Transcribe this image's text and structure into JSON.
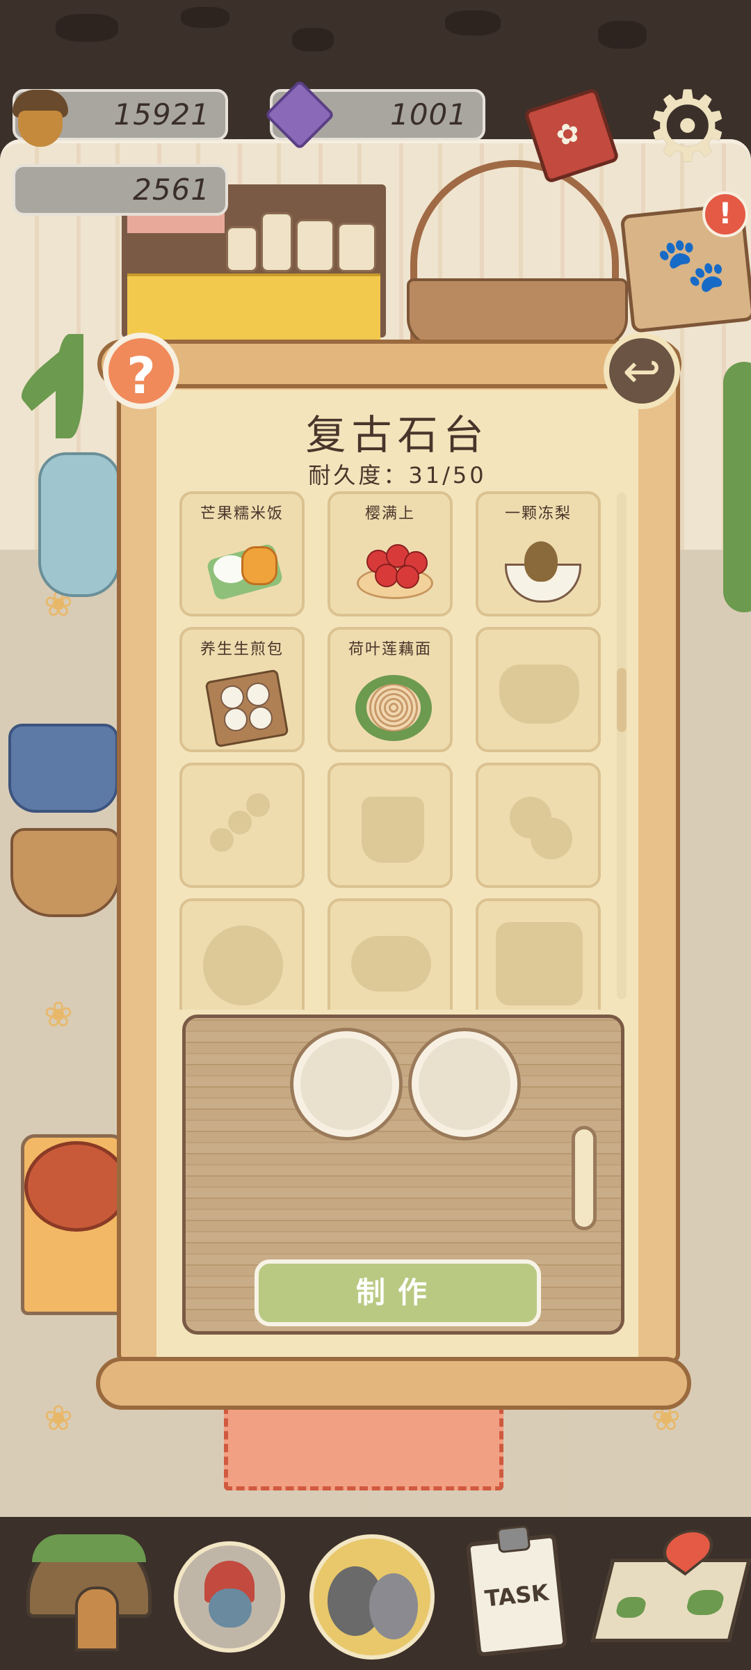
{
  "hud": {
    "acorns": "15921",
    "gems": "1001",
    "hearts": "2561"
  },
  "panel": {
    "title": "复古石台",
    "durability": "耐久度：31/50",
    "make_label": "制作"
  },
  "recipes": [
    {
      "name": "芒果糯米饭",
      "unlocked": true
    },
    {
      "name": "樱满上",
      "unlocked": true
    },
    {
      "name": "一颗冻梨",
      "unlocked": true
    },
    {
      "name": "养生生煎包",
      "unlocked": true
    },
    {
      "name": "荷叶莲藕面",
      "unlocked": true
    },
    {
      "name": "",
      "unlocked": false
    },
    {
      "name": "",
      "unlocked": false
    },
    {
      "name": "",
      "unlocked": false
    },
    {
      "name": "",
      "unlocked": false
    },
    {
      "name": "",
      "unlocked": false
    },
    {
      "name": "",
      "unlocked": false
    },
    {
      "name": "",
      "unlocked": false
    }
  ],
  "nav": {
    "task_label": "TASK"
  },
  "colors": {
    "panel_bg": "#f3e4bc",
    "make_button": "#b9c982",
    "help_button": "#f08a5a",
    "alert": "#e45a45"
  }
}
